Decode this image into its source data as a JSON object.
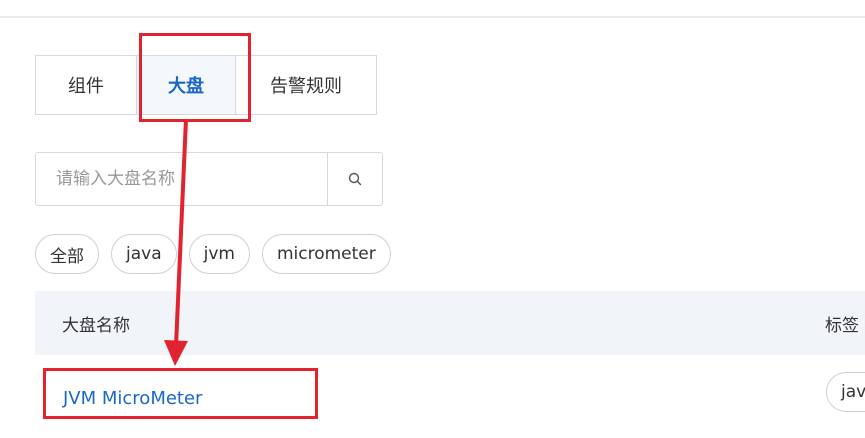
{
  "tabs": [
    {
      "label": "组件",
      "active": false
    },
    {
      "label": "大盘",
      "active": true
    },
    {
      "label": "告警规则",
      "active": false
    }
  ],
  "search": {
    "placeholder": "请输入大盘名称",
    "value": ""
  },
  "tag_filters": [
    "全部",
    "java",
    "jvm",
    "micrometer"
  ],
  "table": {
    "columns": [
      "大盘名称",
      "标签"
    ],
    "rows": [
      {
        "name": "JVM MicroMeter",
        "tag": "java"
      }
    ]
  },
  "colors": {
    "accent": "#1a67c9",
    "annotation": "#e0232e",
    "header_bg": "#f1f4f8"
  },
  "icons": {
    "search": "magnifier-icon"
  }
}
